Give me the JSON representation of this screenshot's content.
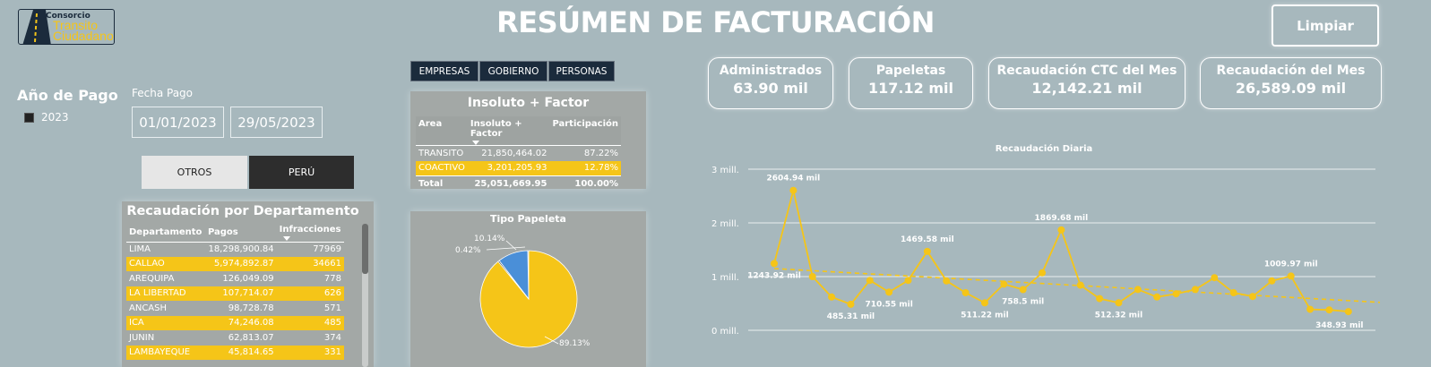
{
  "logo": {
    "line1": "Consorcio",
    "line2": "Transito",
    "line3": "Ciudadano"
  },
  "title": "RESÚMEN DE FACTURACIÓN",
  "clear_button": "Limpiar",
  "year_filter": {
    "title": "Año de Pago",
    "option": "2023"
  },
  "date_filter": {
    "label": "Fecha Pago",
    "from": "01/01/2023",
    "to": "29/05/2023"
  },
  "toggle": {
    "left": "OTROS",
    "right": "PERÚ"
  },
  "segments": [
    "EMPRESAS",
    "GOBIERNO",
    "PERSONAS"
  ],
  "departamento": {
    "title": "Recaudación por Departamento",
    "columns": [
      "Departamento",
      "Pagos",
      "Infracciones"
    ],
    "rows": [
      [
        "LIMA",
        "18,298,900.84",
        "77969"
      ],
      [
        "CALLAO",
        "5,974,892.87",
        "34661"
      ],
      [
        "AREQUIPA",
        "126,049.09",
        "778"
      ],
      [
        "LA LIBERTAD",
        "107,714.07",
        "626"
      ],
      [
        "ANCASH",
        "98,728.78",
        "571"
      ],
      [
        "ICA",
        "74,246.08",
        "485"
      ],
      [
        "JUNIN",
        "62,813.07",
        "374"
      ],
      [
        "LAMBAYEQUE",
        "45,814.65",
        "331"
      ]
    ]
  },
  "insoluto": {
    "title": "Insoluto + Factor",
    "columns": [
      "Area",
      "Insoluto + Factor",
      "Participación"
    ],
    "rows": [
      [
        "TRANSITO",
        "21,850,464.02",
        "87.22%"
      ],
      [
        "COACTIVO",
        "3,201,205.93",
        "12.78%"
      ]
    ],
    "total": [
      "Total",
      "25,051,669.95",
      "100.00%"
    ]
  },
  "pie": {
    "title": "Tipo Papeleta",
    "colors": {
      "main": "#f5c518",
      "second": "#4a8fd8",
      "third": "#1b2b3c"
    },
    "labels": [
      "89.13%",
      "10.14%",
      "0.42%"
    ]
  },
  "kpis": [
    {
      "label": "Administrados",
      "value": "63.90 mil"
    },
    {
      "label": "Papeletas",
      "value": "117.12 mil"
    },
    {
      "label": "Recaudación CTC del Mes",
      "value": "12,142.21 mil"
    },
    {
      "label": "Recaudación del Mes",
      "value": "26,589.09 mil"
    }
  ],
  "chart_data": {
    "type": "line",
    "title": "Recaudación Diaria",
    "y_ticks": [
      "3 mill.",
      "2 mill.",
      "1 mill.",
      "0 mill."
    ],
    "ylim": [
      0,
      3000
    ],
    "values": [
      1243.92,
      2604.94,
      1000,
      620,
      485.31,
      930,
      710.55,
      930,
      1469.58,
      920,
      700,
      511.22,
      860,
      758.5,
      1070,
      1869.68,
      840,
      590,
      512.32,
      760,
      620,
      680,
      760,
      980,
      700,
      630,
      920,
      1009.97,
      390,
      380,
      348.93
    ],
    "data_labels": [
      {
        "index": 0,
        "text": "1243.92 mil"
      },
      {
        "index": 1,
        "text": "2604.94 mil"
      },
      {
        "index": 4,
        "text": "485.31 mil"
      },
      {
        "index": 6,
        "text": "710.55 mil"
      },
      {
        "index": 8,
        "text": "1469.58 mil"
      },
      {
        "index": 11,
        "text": "511.22 mil"
      },
      {
        "index": 13,
        "text": "758.5 mil"
      },
      {
        "index": 15,
        "text": "1869.68 mil"
      },
      {
        "index": 18,
        "text": "512.32 mil"
      },
      {
        "index": 27,
        "text": "1009.97 mil"
      },
      {
        "index": 30,
        "text": "348.93 mil"
      }
    ],
    "trend": [
      1150,
      520
    ],
    "line_color": "#f5c518",
    "grid": true
  }
}
